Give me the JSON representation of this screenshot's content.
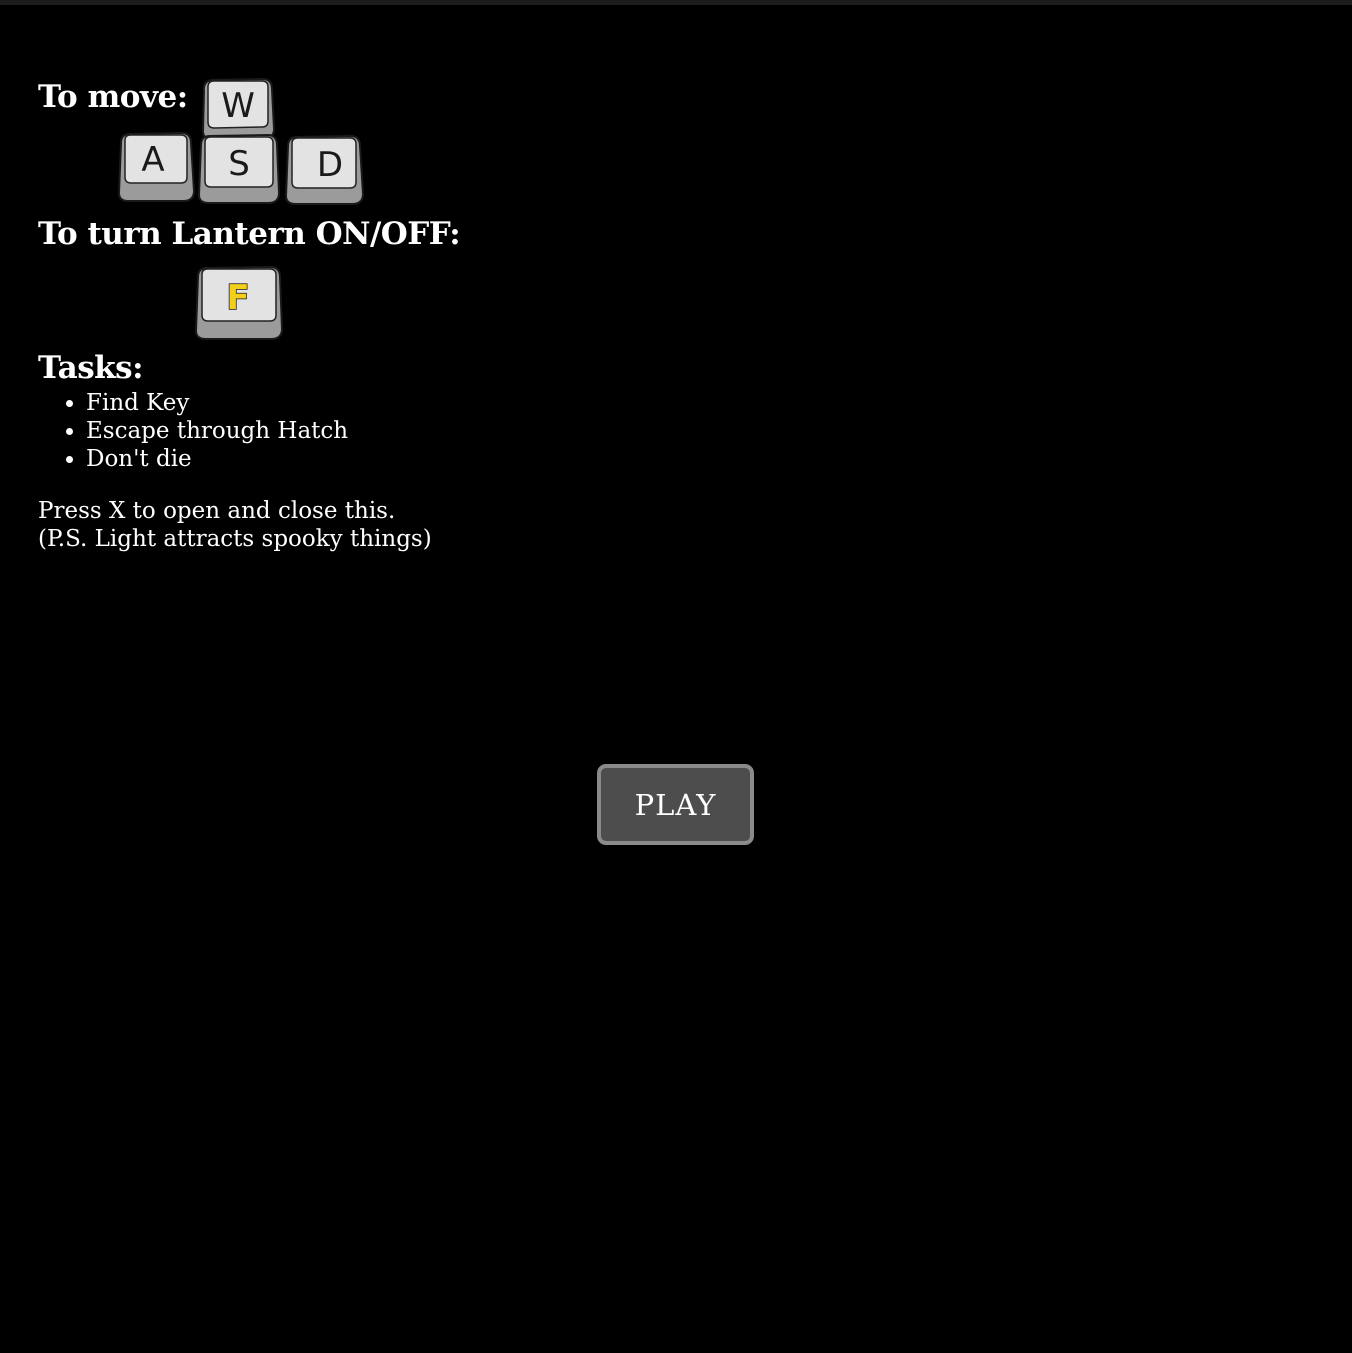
{
  "instructions": {
    "move_label": "To move:",
    "move_keys": {
      "up": "W",
      "left": "A",
      "down": "S",
      "right": "D"
    },
    "lantern_label": "To turn Lantern ON/OFF:",
    "lantern_key": "F",
    "tasks_label": "Tasks:",
    "tasks": [
      "Find Key",
      "Escape through Hatch",
      "Don't die"
    ],
    "note_line1": "Press X to open and close this.",
    "note_line2": "(P.S. Light attracts spooky things)"
  },
  "play_button": {
    "label": "PLAY"
  },
  "colors": {
    "background": "#000000",
    "text": "#ffffff",
    "key_face": "#e3e3e3",
    "key_letter": "#1a1a1a",
    "lantern_key_letter": "#f2cf1b",
    "button_fill": "#4d4d4d",
    "button_border": "#8a8a8a"
  },
  "icons": [
    "keycap-w-icon",
    "keycap-a-icon",
    "keycap-s-icon",
    "keycap-d-icon",
    "keycap-f-icon"
  ]
}
